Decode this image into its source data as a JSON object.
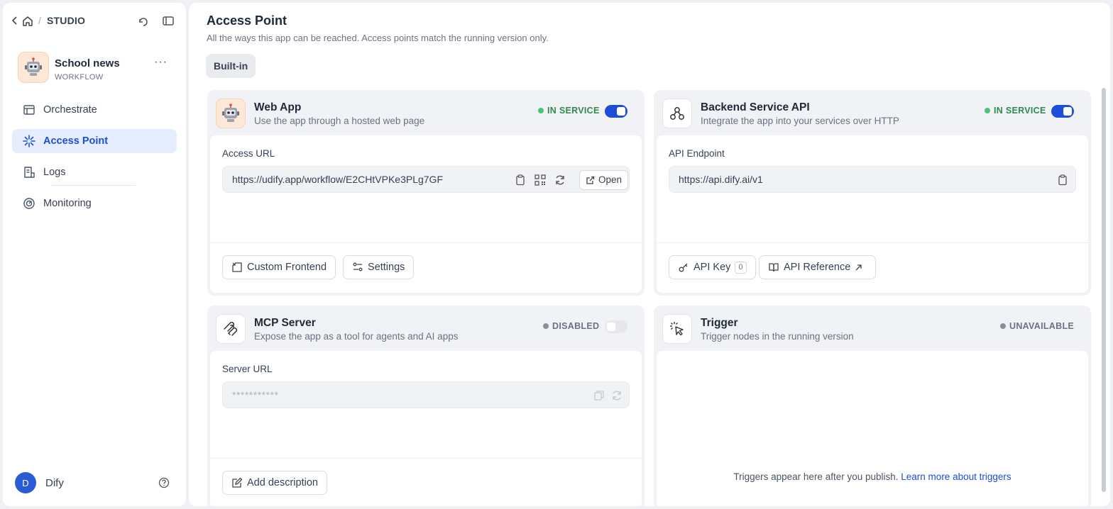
{
  "breadcrumb": {
    "section": "STUDIO"
  },
  "app": {
    "name": "School news",
    "type": "WORKFLOW",
    "more": "···"
  },
  "nav": [
    {
      "label": "Orchestrate"
    },
    {
      "label": "Access Point"
    },
    {
      "label": "Logs"
    },
    {
      "label": "Monitoring"
    }
  ],
  "user": {
    "initial": "D",
    "name": "Dify"
  },
  "page": {
    "title": "Access Point",
    "subtitle": "All the ways this app can be reached. Access points match the running version only.",
    "tab": "Built-in"
  },
  "webapp": {
    "title": "Web App",
    "desc": "Use the app through a hosted web page",
    "status": "IN SERVICE",
    "field_label": "Access URL",
    "url": "https://udify.app/workflow/E2CHtVPKe3PLg7GF",
    "open_label": "Open",
    "custom_frontend_label": "Custom Frontend",
    "settings_label": "Settings"
  },
  "api": {
    "title": "Backend Service API",
    "desc": "Integrate the app into your services over HTTP",
    "status": "IN SERVICE",
    "field_label": "API Endpoint",
    "url": "https://api.dify.ai/v1",
    "api_key_label": "API Key",
    "api_key_count": "0",
    "api_ref_label": "API Reference"
  },
  "mcp": {
    "title": "MCP Server",
    "desc": "Expose the app as a tool for agents and AI apps",
    "status": "DISABLED",
    "field_label": "Server URL",
    "url": "***********",
    "add_desc_label": "Add description"
  },
  "trigger": {
    "title": "Trigger",
    "desc": "Trigger nodes in the running version",
    "status": "UNAVAILABLE",
    "message": "Triggers appear here after you publish.",
    "link": "Learn more about triggers"
  },
  "colors": {
    "accent": "#1d4ed8",
    "green": "#2f8a4f",
    "user_avatar": "#2a5bd7"
  }
}
